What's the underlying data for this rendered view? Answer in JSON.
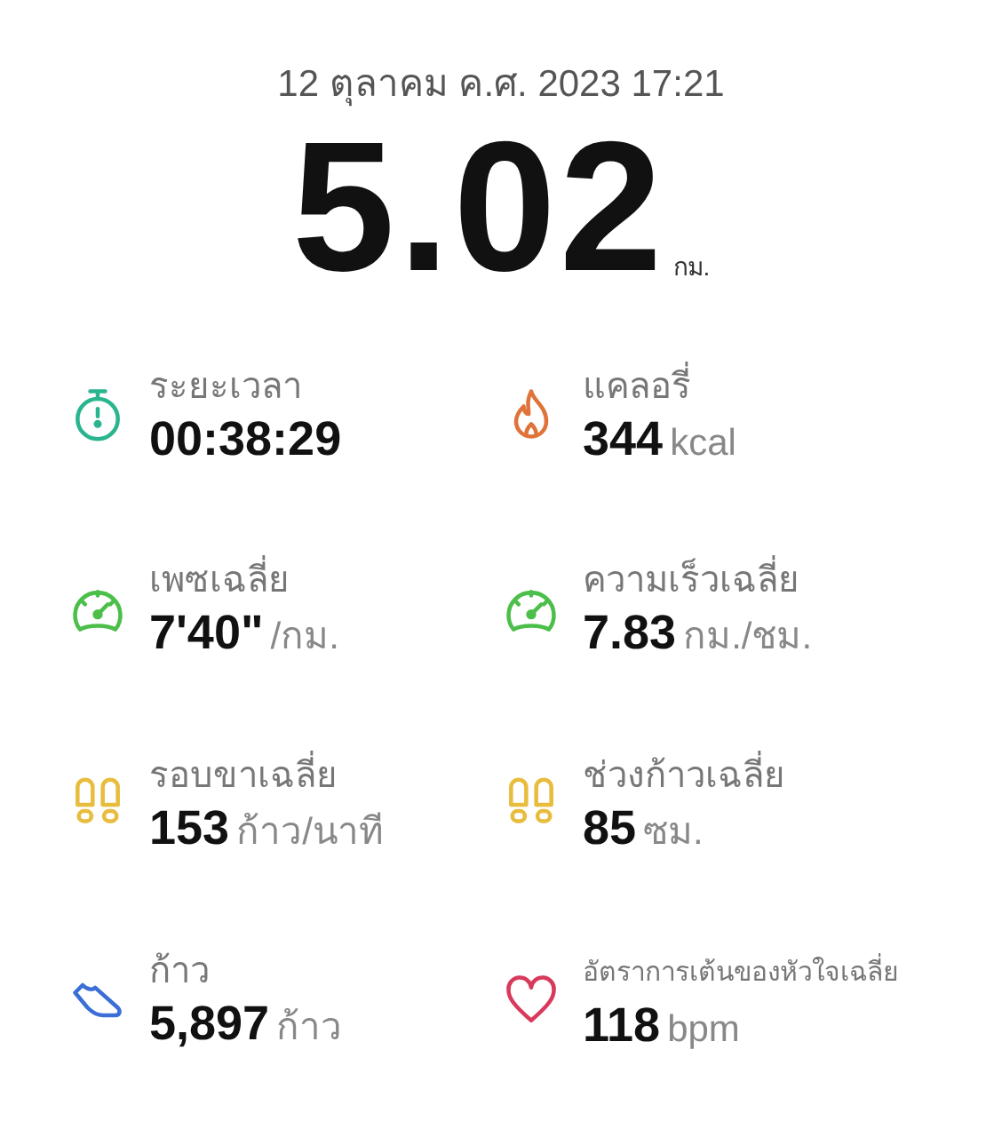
{
  "header": {
    "date": "12 ตุลาคม ค.ศ. 2023 17:21",
    "distance": "5.02",
    "distance_unit": "กม."
  },
  "stats": [
    {
      "kind": "stopwatch",
      "color": "#2bb58f",
      "label": "ระยะเวลา",
      "value": "00:38:29",
      "compact": false
    },
    {
      "kind": "flame",
      "color": "#e0733a",
      "label": "แคลอรี่",
      "value": "344",
      "unit": "kcal",
      "compact": false
    },
    {
      "kind": "gauge",
      "color": "#4cbf4a",
      "label": "เพซเฉลี่ย",
      "value": "7'40\"",
      "unit": "/กม.",
      "compact": false
    },
    {
      "kind": "gauge",
      "color": "#4cbf4a",
      "label": "ความเร็วเฉลี่ย",
      "value": "7.83",
      "unit": "กม./ชม.",
      "compact": false
    },
    {
      "kind": "footprints",
      "color": "#e8bc3c",
      "label": "รอบขาเฉลี่ย",
      "value": "153",
      "unit": "ก้าว/นาที",
      "compact": false
    },
    {
      "kind": "footprints",
      "color": "#e8bc3c",
      "label": "ช่วงก้าวเฉลี่ย",
      "value": "85",
      "unit": "ซม.",
      "compact": false
    },
    {
      "kind": "shoe",
      "color": "#3b6fd6",
      "label": "ก้าว",
      "value": "5,897",
      "unit": "ก้าว",
      "compact": false
    },
    {
      "kind": "heart",
      "color": "#d93a5c",
      "label": "อัตราการเต้นของหัวใจเฉลี่ย",
      "value": "118",
      "unit": "bpm",
      "compact": true
    }
  ]
}
